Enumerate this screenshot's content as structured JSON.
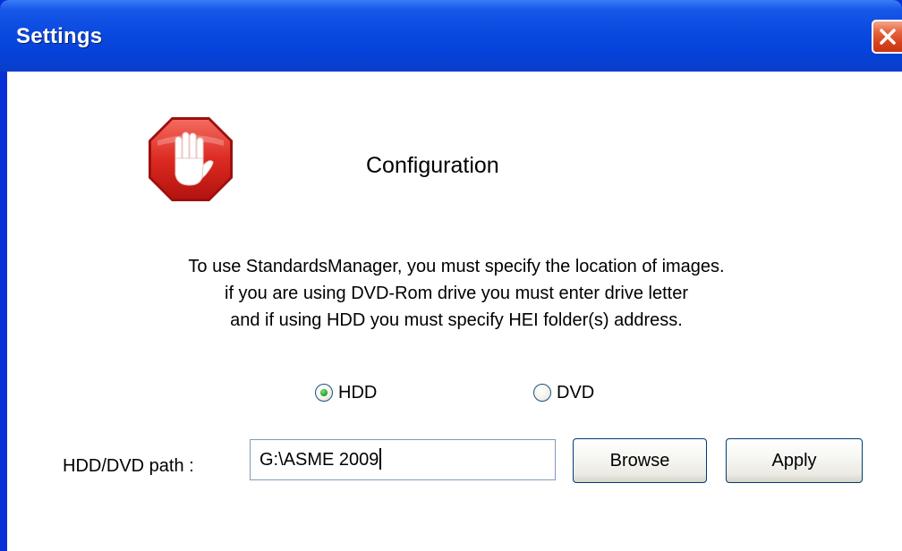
{
  "window": {
    "title": "Settings"
  },
  "dialog": {
    "heading": "Configuration",
    "description": [
      "To use StandardsManager, you must specify the location of images.",
      "if you are using DVD-Rom drive you must enter drive letter",
      "and if using HDD you must specify HEI folder(s) address."
    ],
    "source_options": [
      {
        "label": "HDD",
        "selected": true
      },
      {
        "label": "DVD",
        "selected": false
      }
    ],
    "path_label": "HDD/DVD path :",
    "path_value": "G:\\ASME 2009",
    "browse_label": "Browse",
    "apply_label": "Apply"
  },
  "icons": {
    "stop": "stop-hand-icon",
    "close": "close-icon"
  },
  "colors": {
    "titlebar": "#0a4ae0",
    "close_button": "#d8421b",
    "stop_icon": "#d81e1e"
  }
}
